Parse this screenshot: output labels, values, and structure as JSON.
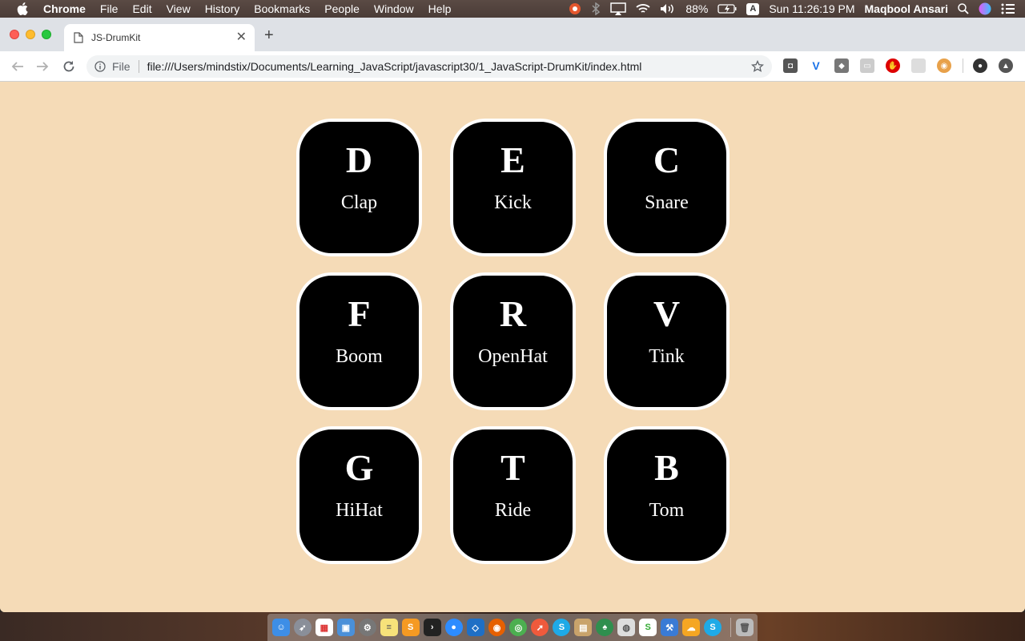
{
  "menubar": {
    "app_name": "Chrome",
    "items": [
      "File",
      "Edit",
      "View",
      "History",
      "Bookmarks",
      "People",
      "Window",
      "Help"
    ],
    "battery": "88%",
    "input_source": "A",
    "clock": "Sun 11:26:19 PM",
    "user": "Maqbool Ansari"
  },
  "browser": {
    "tab_title": "JS-DrumKit",
    "scheme_label": "File",
    "url": "file:///Users/mindstix/Documents/Learning_JavaScript/javascript30/1_JavaScript-DrumKit/index.html"
  },
  "keys": [
    {
      "key": "D",
      "sound": "Clap"
    },
    {
      "key": "E",
      "sound": "Kick"
    },
    {
      "key": "C",
      "sound": "Snare"
    },
    {
      "key": "F",
      "sound": "Boom"
    },
    {
      "key": "R",
      "sound": "OpenHat"
    },
    {
      "key": "V",
      "sound": "Tink"
    },
    {
      "key": "G",
      "sound": "HiHat"
    },
    {
      "key": "T",
      "sound": "Ride"
    },
    {
      "key": "B",
      "sound": "Tom"
    }
  ],
  "colors": {
    "page_background": "#f5dbb7",
    "key_background": "#000000",
    "key_border": "#ffffff"
  },
  "icons": {
    "menubar_right": [
      "chrome-profile-icon",
      "bluetooth-icon",
      "airplay-icon",
      "wifi-icon",
      "volume-icon",
      "battery-icon",
      "spotlight-icon",
      "siri-icon",
      "notification-center-icon"
    ],
    "extensions": [
      "extension-ghostery-icon",
      "extension-vue-devtools-icon",
      "extension-layers-icon",
      "extension-screen-icon",
      "extension-adblock-icon",
      "extension-grid-icon",
      "extension-owl-icon",
      "profile-avatar-icon",
      "extension-upload-icon"
    ]
  }
}
